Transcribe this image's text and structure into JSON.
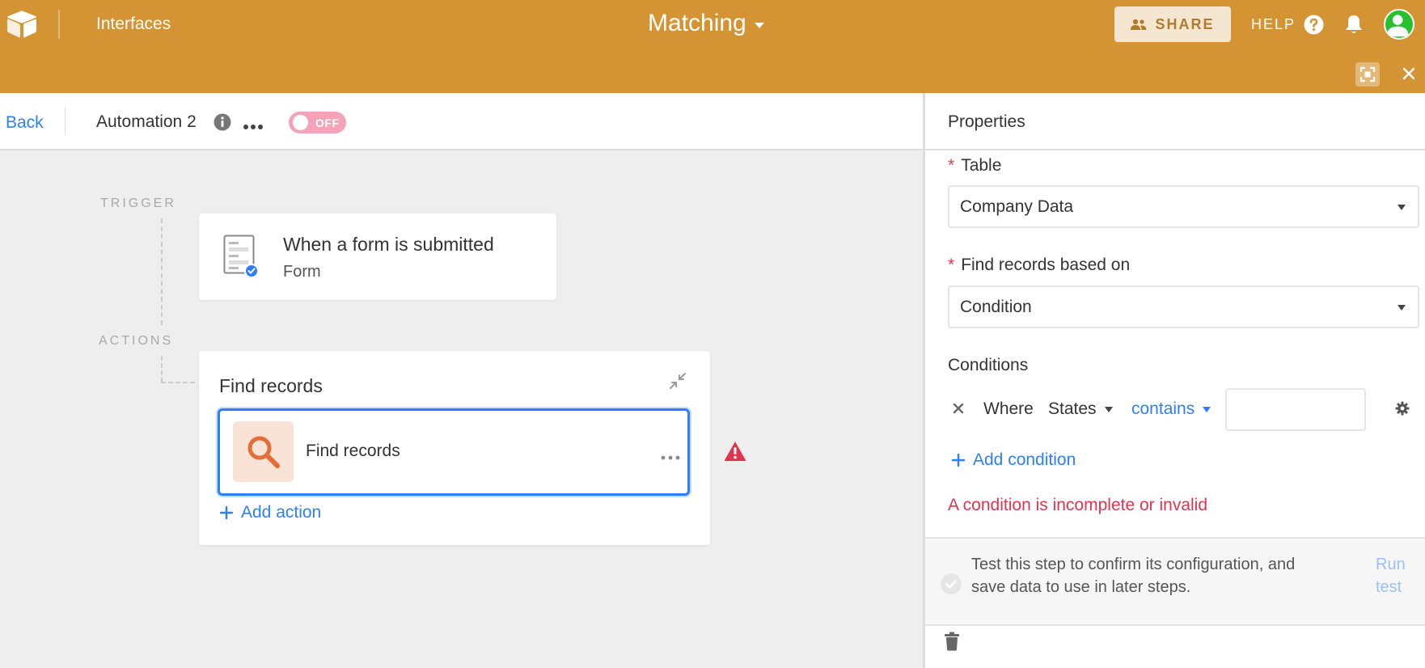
{
  "header": {
    "interfaces_label": "Interfaces",
    "base_title": "Matching",
    "share_label": "SHARE",
    "help_label": "HELP",
    "colors": {
      "header_bg": "#d49434",
      "accent_blue": "#2d7ff9",
      "error_red": "#e0354f"
    }
  },
  "toolbar": {
    "back_label": "Back",
    "automation_name": "Automation 2",
    "toggle_label": "OFF"
  },
  "canvas": {
    "trigger_section_label": "TRIGGER",
    "actions_section_label": "ACTIONS",
    "trigger": {
      "title": "When a form is submitted",
      "subtitle": "Form",
      "icon": "form-icon"
    },
    "actions_group": {
      "title": "Find records",
      "steps": [
        {
          "label": "Find records",
          "icon": "search-icon",
          "status": "warning"
        }
      ],
      "add_action_label": "Add action"
    }
  },
  "panel": {
    "title": "Properties",
    "table": {
      "label": "Table",
      "value": "Company Data"
    },
    "find_based_on": {
      "label": "Find records based on",
      "value": "Condition"
    },
    "conditions": {
      "label": "Conditions",
      "rows": [
        {
          "prefix": "Where",
          "field": "States",
          "operator": "contains",
          "value": ""
        }
      ],
      "add_label": "Add condition"
    },
    "error_message": "A condition is incomplete or invalid",
    "test": {
      "description": "Test this step to confirm its configuration, and save data to use in later steps.",
      "run_label": "Run test"
    }
  }
}
